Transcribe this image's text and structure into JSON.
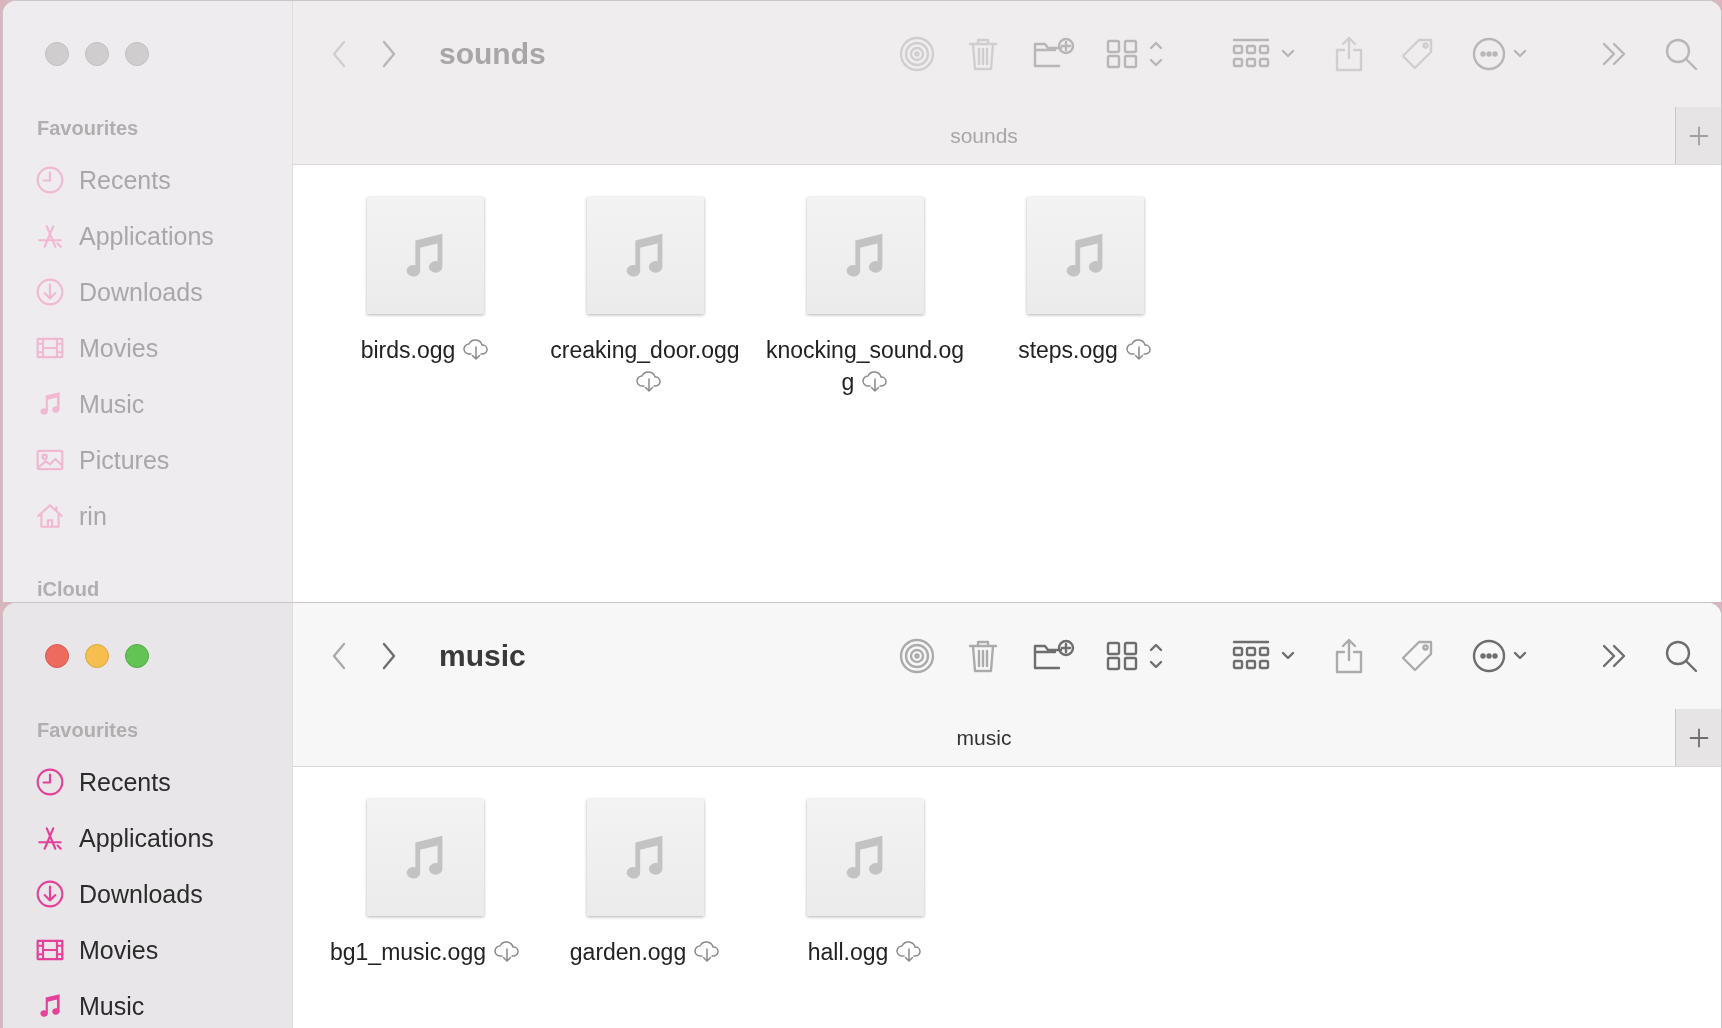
{
  "windows": [
    {
      "title": "sounds",
      "active": false,
      "sidebar": {
        "heading": "Favourites",
        "items": [
          {
            "label": "Recents",
            "kind": "clock"
          },
          {
            "label": "Applications",
            "kind": "apps"
          },
          {
            "label": "Downloads",
            "kind": "download"
          },
          {
            "label": "Movies",
            "kind": "film"
          },
          {
            "label": "Music",
            "kind": "note"
          },
          {
            "label": "Pictures",
            "kind": "picture"
          },
          {
            "label": "rin",
            "kind": "home"
          }
        ],
        "next_heading": "iCloud"
      },
      "tab": "sounds",
      "files": [
        {
          "name": "birds.ogg"
        },
        {
          "name": "creaking_door.ogg"
        },
        {
          "name": "knocking_sound.ogg"
        },
        {
          "name": "steps.ogg"
        }
      ]
    },
    {
      "title": "music",
      "active": true,
      "sidebar": {
        "heading": "Favourites",
        "items": [
          {
            "label": "Recents",
            "kind": "clock"
          },
          {
            "label": "Applications",
            "kind": "apps"
          },
          {
            "label": "Downloads",
            "kind": "download"
          },
          {
            "label": "Movies",
            "kind": "film"
          },
          {
            "label": "Music",
            "kind": "note"
          }
        ]
      },
      "tab": "music",
      "files": [
        {
          "name": "bg1_music.ogg"
        },
        {
          "name": "garden.ogg"
        },
        {
          "name": "hall.ogg"
        }
      ]
    }
  ]
}
